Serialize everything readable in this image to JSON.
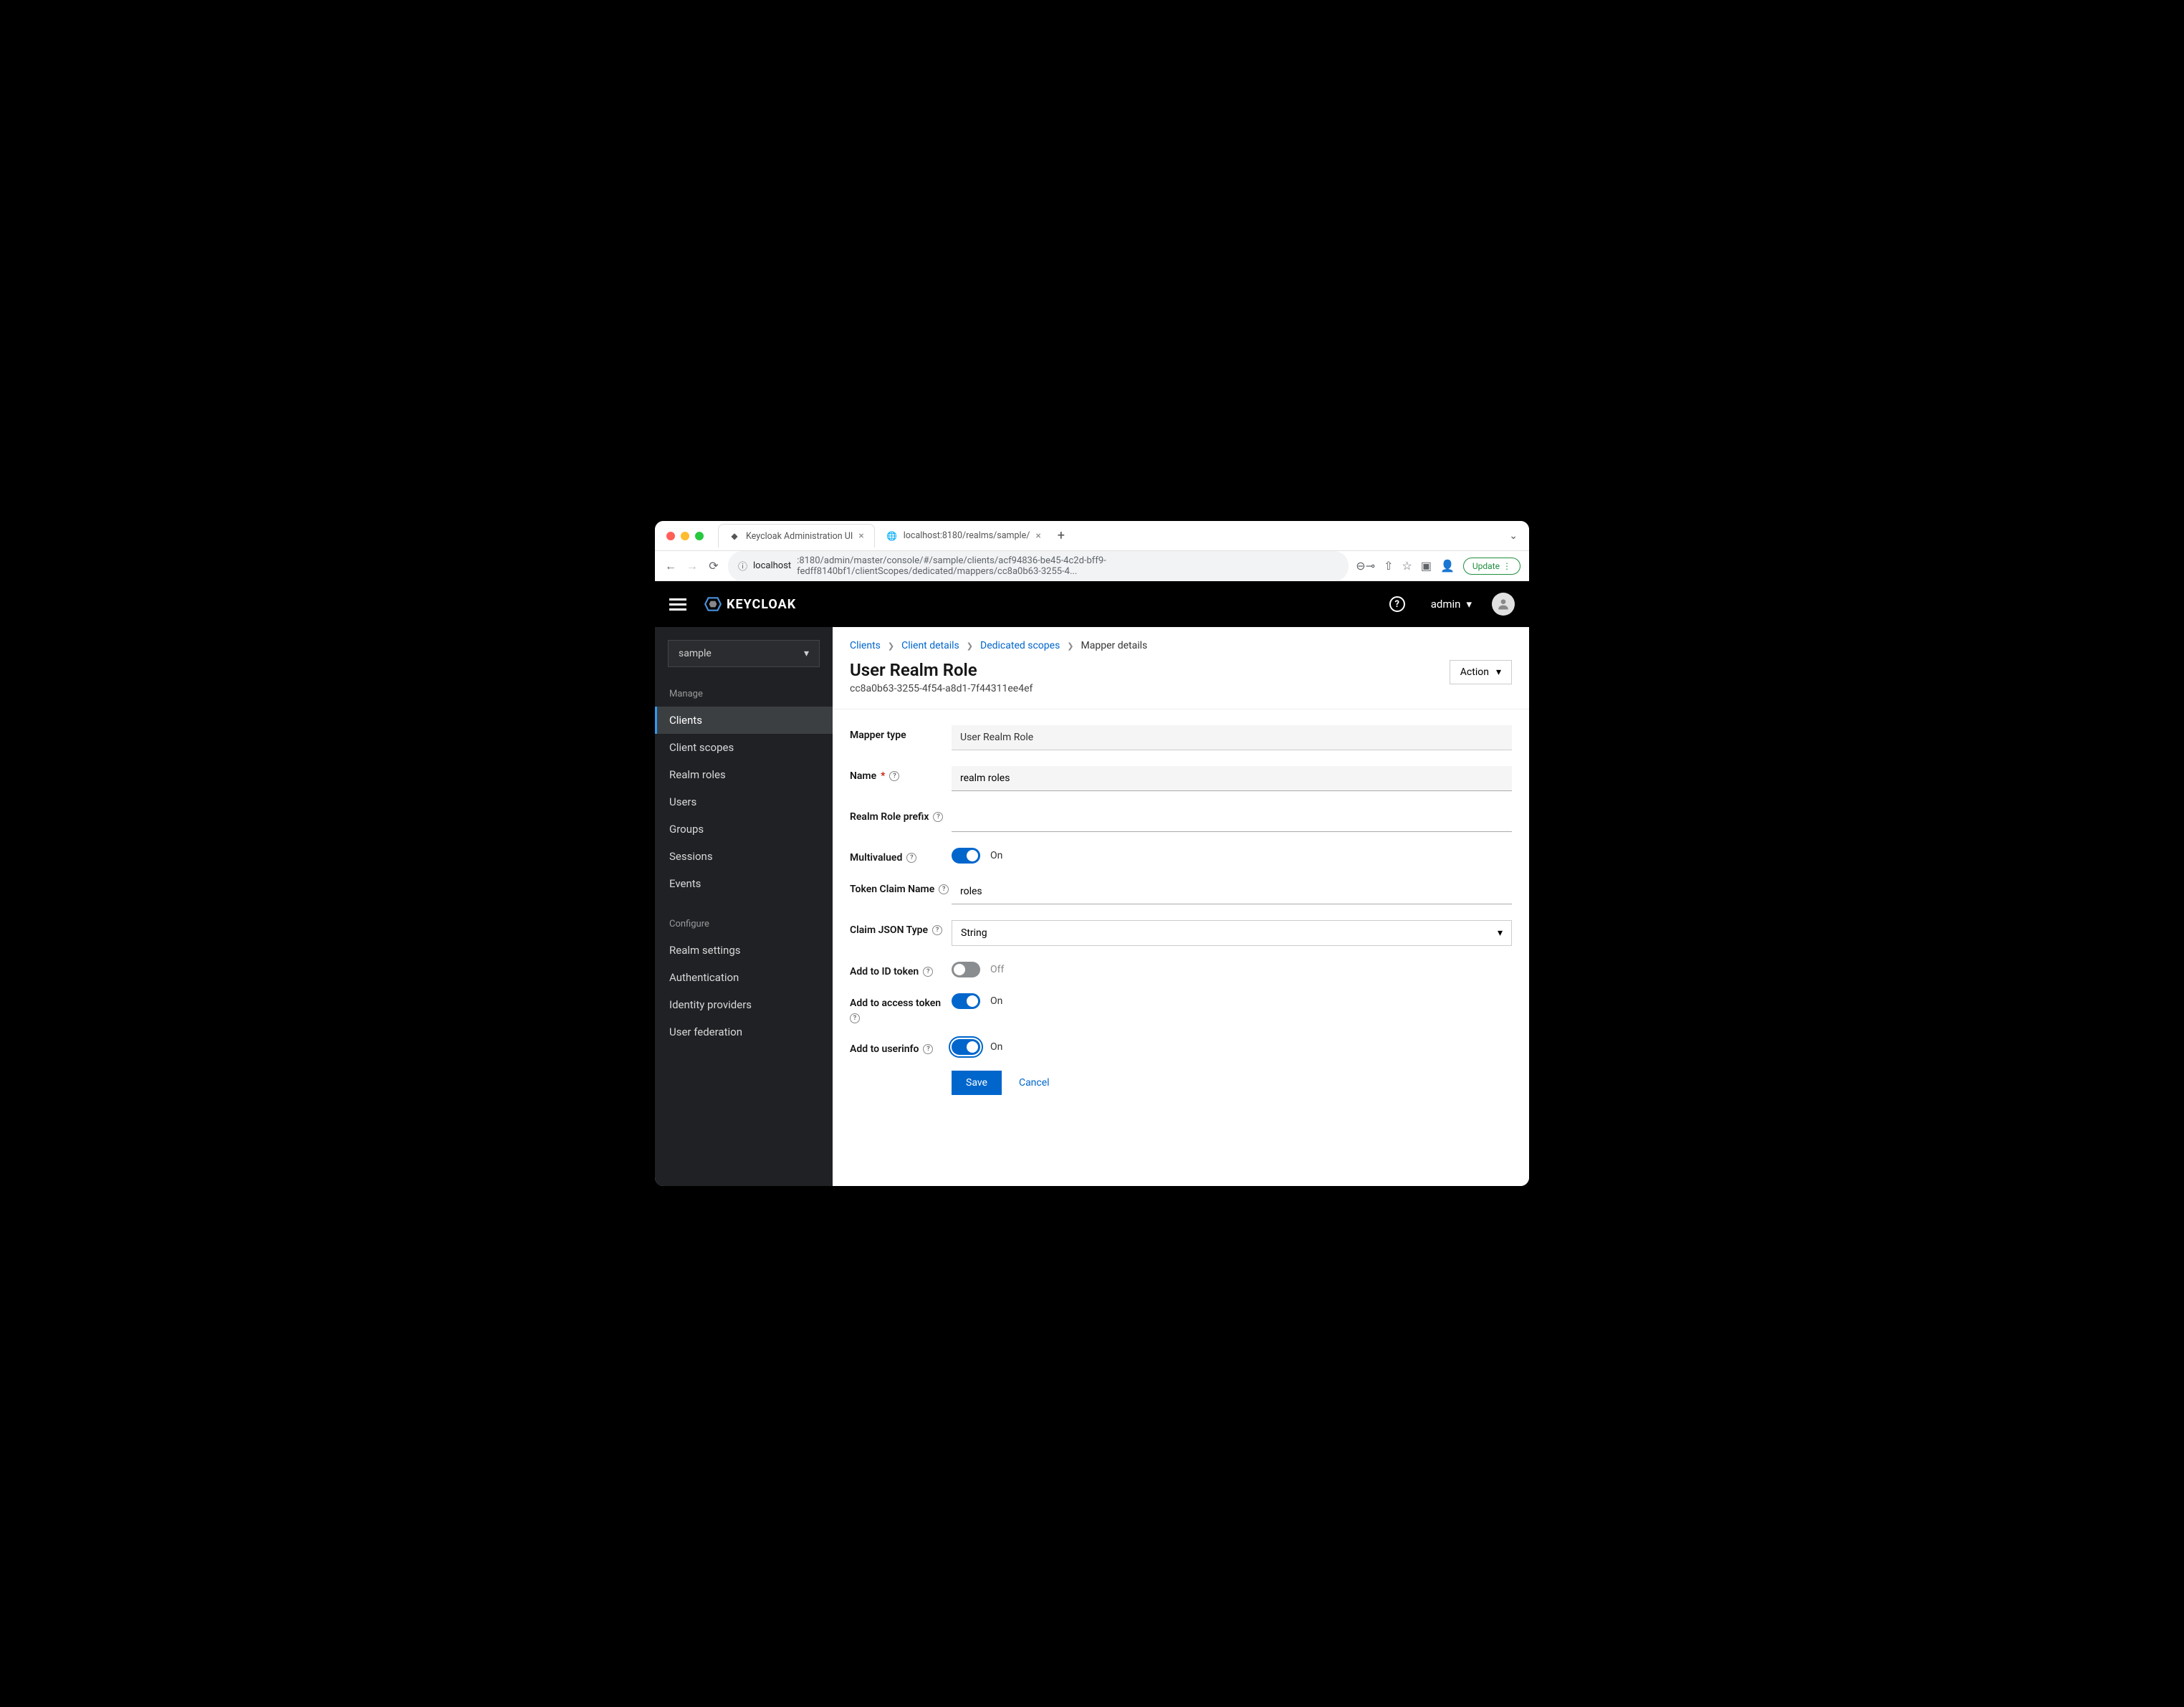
{
  "browser": {
    "tabs": [
      {
        "title": "Keycloak Administration UI",
        "active": true
      },
      {
        "title": "localhost:8180/realms/sample/",
        "active": false
      }
    ],
    "addr_host": "localhost",
    "addr_path": ":8180/admin/master/console/#/sample/clients/acf94836-be45-4c2d-bff9-fedff8140bf1/clientScopes/dedicated/mappers/cc8a0b63-3255-4...",
    "update_label": "Update"
  },
  "topbar": {
    "brand": "KEYCLOAK",
    "user": "admin"
  },
  "sidebar": {
    "realm": "sample",
    "sections": [
      {
        "header": "Manage",
        "items": [
          "Clients",
          "Client scopes",
          "Realm roles",
          "Users",
          "Groups",
          "Sessions",
          "Events"
        ],
        "active": "Clients"
      },
      {
        "header": "Configure",
        "items": [
          "Realm settings",
          "Authentication",
          "Identity providers",
          "User federation"
        ]
      }
    ]
  },
  "breadcrumb": {
    "items": [
      "Clients",
      "Client details",
      "Dedicated scopes"
    ],
    "current": "Mapper details"
  },
  "header": {
    "title": "User Realm Role",
    "subtitle": "cc8a0b63-3255-4f54-a8d1-7f44311ee4ef",
    "action": "Action"
  },
  "form": {
    "fields": {
      "mapper_type": {
        "label": "Mapper type",
        "value": "User Realm Role"
      },
      "name": {
        "label": "Name",
        "value": "realm roles",
        "required": true
      },
      "prefix": {
        "label": "Realm Role prefix",
        "value": ""
      },
      "multivalued": {
        "label": "Multivalued",
        "on": true,
        "text": "On"
      },
      "token_claim": {
        "label": "Token Claim Name",
        "value": "roles"
      },
      "json_type": {
        "label": "Claim JSON Type",
        "value": "String"
      },
      "id_token": {
        "label": "Add to ID token",
        "on": false,
        "text": "Off"
      },
      "access_token": {
        "label": "Add to access token",
        "on": true,
        "text": "On"
      },
      "userinfo": {
        "label": "Add to userinfo",
        "on": true,
        "text": "On",
        "focused": true
      }
    },
    "save": "Save",
    "cancel": "Cancel"
  }
}
